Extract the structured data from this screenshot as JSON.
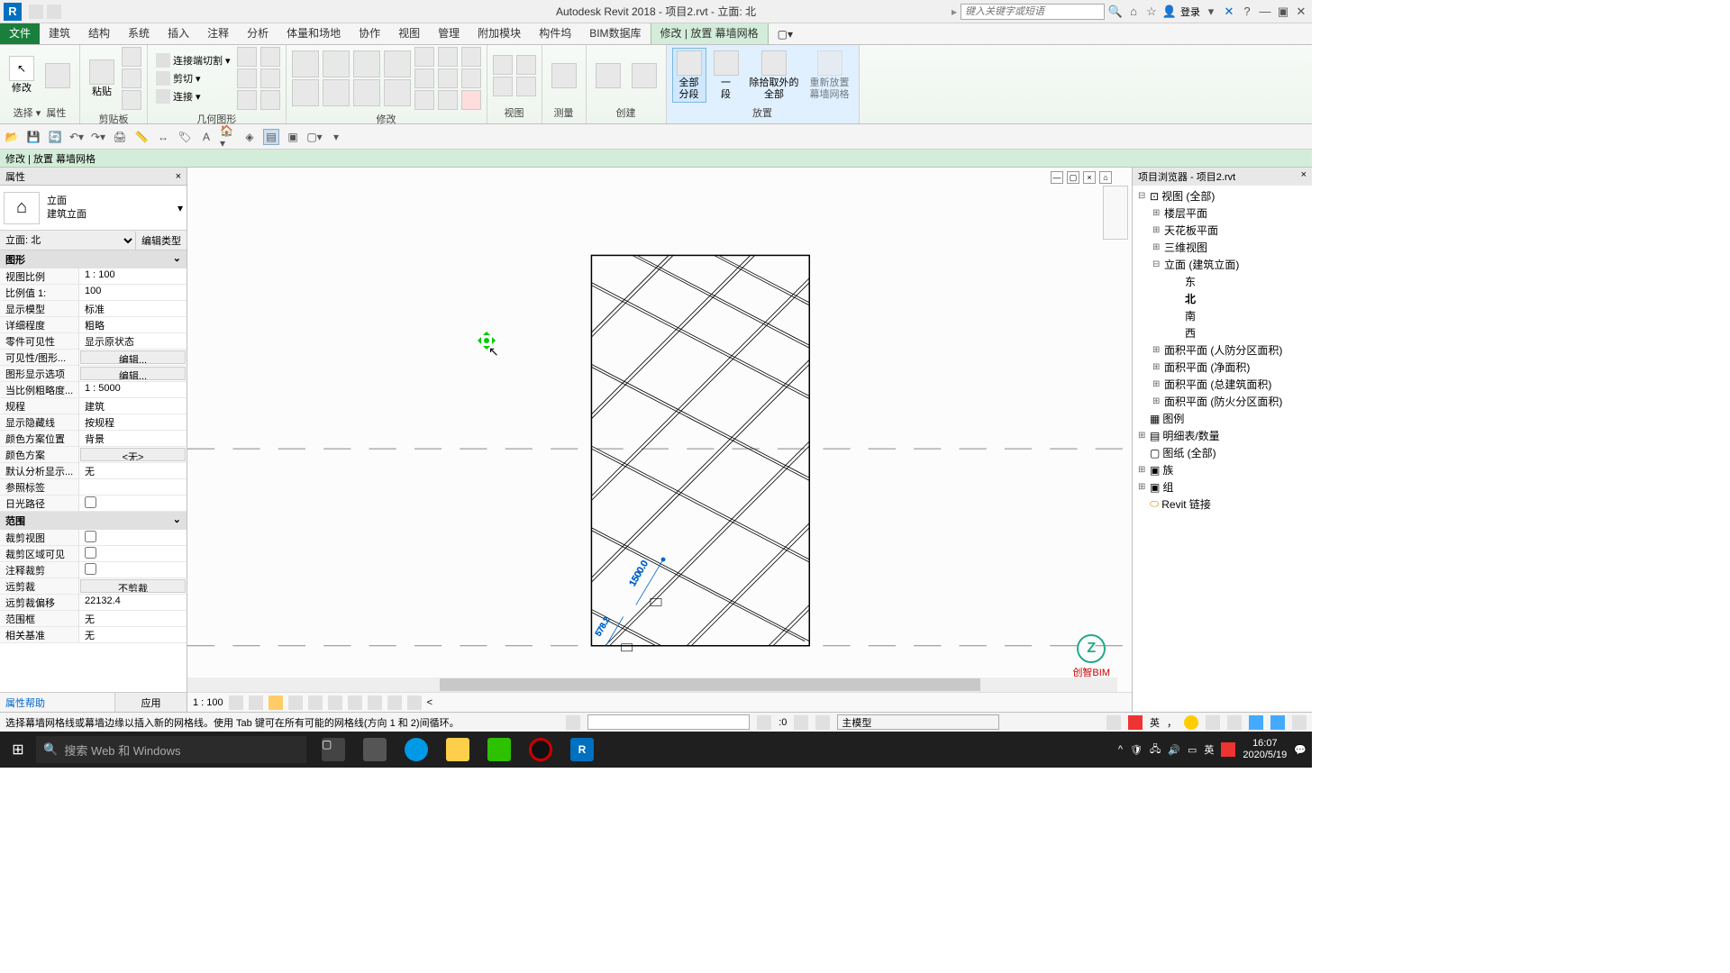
{
  "title": "Autodesk Revit 2018 -   项目2.rvt - 立面: 北",
  "search_placeholder": "键入关键字或短语",
  "login": "登录",
  "ribbon_tabs": {
    "file": "文件",
    "arch": "建筑",
    "struct": "结构",
    "system": "系统",
    "insert": "插入",
    "annotate": "注释",
    "analyze": "分析",
    "mass": "体量和场地",
    "collab": "协作",
    "view": "视图",
    "manage": "管理",
    "addin": "附加模块",
    "gjb": "构件坞",
    "bim": "BIM数据库",
    "modify": "修改 | 放置 幕墙网格"
  },
  "ribbon_groups": {
    "select": "选择 ▾",
    "props": "属性",
    "clipboard": "剪贴板",
    "paste": "粘贴",
    "geom": "几何图形",
    "cut": "剪切",
    "join": "连接",
    "cope": "连接端切割",
    "modify": "修改",
    "view": "视图",
    "measure": "测量",
    "create": "创建",
    "place": "放置",
    "all_seg": "全部\n分段",
    "one_seg": "一\n段",
    "except": "除拾取外的\n全部",
    "replace": "重新放置\n幕墙网格",
    "modify_lbl": "修改"
  },
  "context_bar": "修改 | 放置 幕墙网格",
  "props_panel": {
    "title": "属性",
    "type_name1": "立面",
    "type_name2": "建筑立面",
    "filter": "立面: 北",
    "edit_type": "编辑类型",
    "cat_graphics": "图形",
    "cat_extent": "范围",
    "rows": {
      "view_scale": {
        "k": "视图比例",
        "v": "1 : 100"
      },
      "scale_val": {
        "k": "比例值 1:",
        "v": "100"
      },
      "disp_model": {
        "k": "显示模型",
        "v": "标准"
      },
      "detail": {
        "k": "详细程度",
        "v": "粗略"
      },
      "part_vis": {
        "k": "零件可见性",
        "v": "显示原状态"
      },
      "vis_graph": {
        "k": "可见性/图形...",
        "v": "编辑..."
      },
      "graph_disp": {
        "k": "图形显示选项",
        "v": "编辑..."
      },
      "scale_coarse": {
        "k": "当比例粗略度...",
        "v": "1 : 5000"
      },
      "discipline": {
        "k": "规程",
        "v": "建筑"
      },
      "hidden": {
        "k": "显示隐藏线",
        "v": "按规程"
      },
      "color_pos": {
        "k": "颜色方案位置",
        "v": "背景"
      },
      "color_scheme": {
        "k": "颜色方案",
        "v": "<无>"
      },
      "analysis": {
        "k": "默认分析显示...",
        "v": "无"
      },
      "ref_label": {
        "k": "参照标签",
        "v": ""
      },
      "sun_path": {
        "k": "日光路径",
        "v": ""
      },
      "crop_view": {
        "k": "裁剪视图",
        "v": ""
      },
      "crop_vis": {
        "k": "裁剪区域可见",
        "v": ""
      },
      "anno_crop": {
        "k": "注释裁剪",
        "v": ""
      },
      "far_clip": {
        "k": "远剪裁",
        "v": "不剪裁"
      },
      "far_offset": {
        "k": "远剪裁偏移",
        "v": "22132.4"
      },
      "scope_box": {
        "k": "范围框",
        "v": "无"
      },
      "assoc_lvl": {
        "k": "相关基准",
        "v": "无"
      }
    },
    "help": "属性帮助",
    "apply": "应用"
  },
  "canvas": {
    "scale": "1 : 100",
    "dim1": "1500.0",
    "dim2": "578.2"
  },
  "browser": {
    "title": "项目浏览器 - 项目2.rvt",
    "views_all": "视图 (全部)",
    "floor_plans": "楼层平面",
    "ceiling_plans": "天花板平面",
    "three_d": "三维视图",
    "elevations": "立面 (建筑立面)",
    "east": "东",
    "north": "北",
    "south": "南",
    "west": "西",
    "area1": "面积平面 (人防分区面积)",
    "area2": "面积平面 (净面积)",
    "area3": "面积平面 (总建筑面积)",
    "area4": "面积平面 (防火分区面积)",
    "legends": "图例",
    "schedules": "明细表/数量",
    "sheets": "图纸 (全部)",
    "families": "族",
    "groups": "组",
    "links": "Revit 链接"
  },
  "status": {
    "msg": "选择幕墙网格线或幕墙边缘以插入新的网格线。使用 Tab 键可在所有可能的网格线(方向 1 和 2)间循环。",
    "zero": ":0",
    "main_model": "主模型"
  },
  "watermark": "创智BIM",
  "taskbar": {
    "search": "搜索 Web 和 Windows",
    "ime": "英",
    "time": "16:07",
    "date": "2020/5/19"
  }
}
